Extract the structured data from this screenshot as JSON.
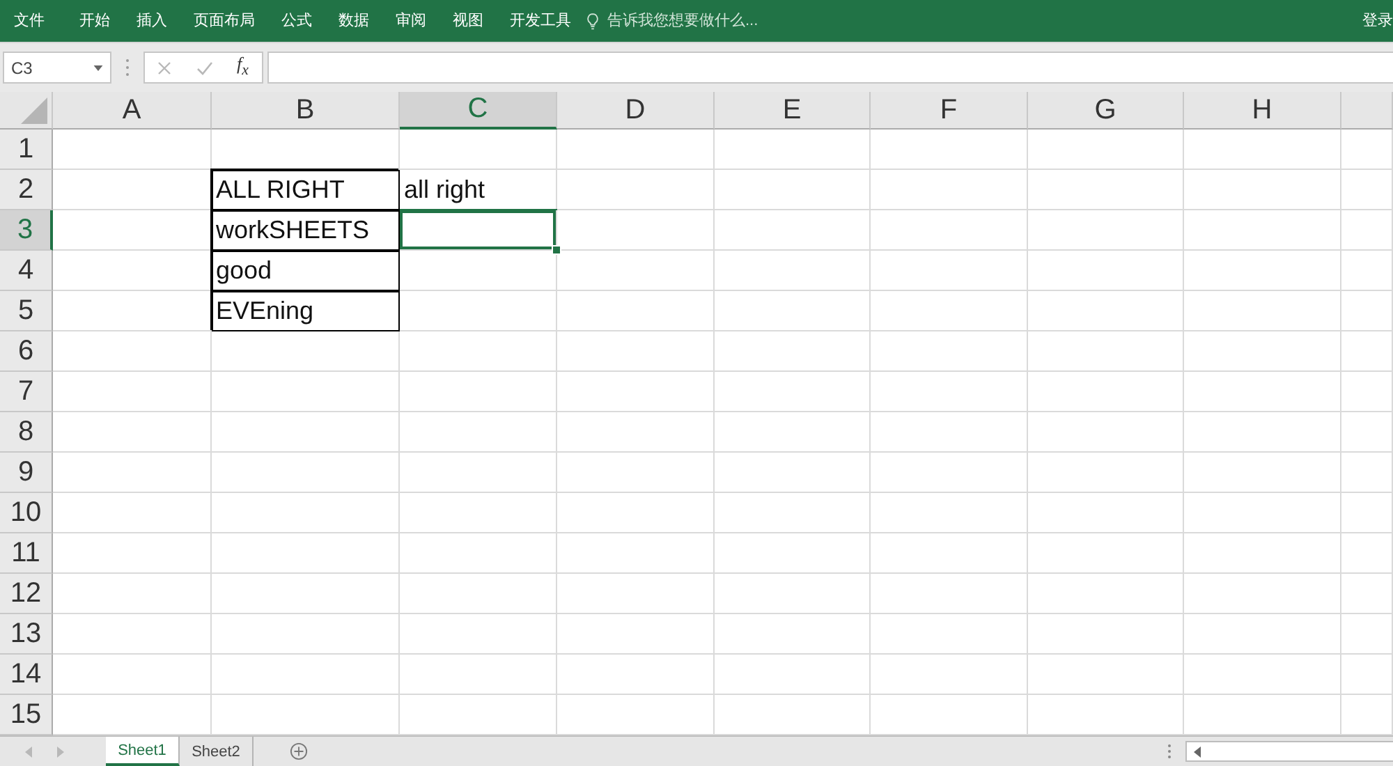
{
  "ribbon": {
    "tabs": [
      {
        "label": "文件",
        "selected": false
      },
      {
        "label": "开始",
        "selected": false
      },
      {
        "label": "插入",
        "selected": false
      },
      {
        "label": "页面布局",
        "selected": false
      },
      {
        "label": "公式",
        "selected": false
      },
      {
        "label": "数据",
        "selected": false
      },
      {
        "label": "审阅",
        "selected": false
      },
      {
        "label": "视图",
        "selected": false
      },
      {
        "label": "开发工具",
        "selected": false
      }
    ],
    "tell_me": {
      "placeholder": "告诉我您想要做什么..."
    },
    "sign_in": "登录"
  },
  "formula_bar": {
    "name_box": "C3",
    "cancel_disabled": true,
    "enter_disabled": true,
    "function_label": "f$_{x}$"
  },
  "columns": [
    {
      "label": "A",
      "selected": false
    },
    {
      "label": "B",
      "selected": false
    },
    {
      "label": "C",
      "selected": true
    },
    {
      "label": "D",
      "selected": false
    },
    {
      "label": "E",
      "selected": false
    },
    {
      "label": "F",
      "selected": false
    },
    {
      "label": "G",
      "selected": false
    },
    {
      "label": "H",
      "selected": false
    }
  ],
  "rows": [
    {
      "label": "1",
      "selected": false,
      "cells": [
        {
          "selected": false,
          "bordered": false
        },
        {
          "selected": false,
          "bordered": false
        },
        {
          "selected": false,
          "bordered": false
        },
        {
          "selected": false,
          "bordered": false
        },
        {
          "selected": false,
          "bordered": false
        },
        {
          "selected": false,
          "bordered": false
        },
        {
          "selected": false,
          "bordered": false
        },
        {
          "selected": false,
          "bordered": false
        }
      ]
    },
    {
      "label": "2",
      "selected": false,
      "cells": [
        {
          "selected": false,
          "bordered": false
        },
        {
          "text": "ALL RIGHT",
          "selected": false,
          "bordered": true
        },
        {
          "text": "all right",
          "selected": false,
          "bordered": false
        },
        {
          "selected": false,
          "bordered": false
        },
        {
          "selected": false,
          "bordered": false
        },
        {
          "selected": false,
          "bordered": false
        },
        {
          "selected": false,
          "bordered": false
        },
        {
          "selected": false,
          "bordered": false
        }
      ]
    },
    {
      "label": "3",
      "selected": true,
      "cells": [
        {
          "selected": false,
          "bordered": false
        },
        {
          "text": "workSHEETS",
          "selected": false,
          "bordered": true
        },
        {
          "selected": true,
          "bordered": false
        },
        {
          "selected": false,
          "bordered": false
        },
        {
          "selected": false,
          "bordered": false
        },
        {
          "selected": false,
          "bordered": false
        },
        {
          "selected": false,
          "bordered": false
        },
        {
          "selected": false,
          "bordered": false
        }
      ]
    },
    {
      "label": "4",
      "selected": false,
      "cells": [
        {
          "selected": false,
          "bordered": false
        },
        {
          "text": "good",
          "selected": false,
          "bordered": true
        },
        {
          "selected": false,
          "bordered": false
        },
        {
          "selected": false,
          "bordered": false
        },
        {
          "selected": false,
          "bordered": false
        },
        {
          "selected": false,
          "bordered": false
        },
        {
          "selected": false,
          "bordered": false
        },
        {
          "selected": false,
          "bordered": false
        }
      ]
    },
    {
      "label": "5",
      "selected": false,
      "cells": [
        {
          "selected": false,
          "bordered": false
        },
        {
          "text": "EVEning",
          "selected": false,
          "bordered": true
        },
        {
          "selected": false,
          "bordered": false
        },
        {
          "selected": false,
          "bordered": false
        },
        {
          "selected": false,
          "bordered": false
        },
        {
          "selected": false,
          "bordered": false
        },
        {
          "selected": false,
          "bordered": false
        },
        {
          "selected": false,
          "bordered": false
        }
      ]
    },
    {
      "label": "6",
      "selected": false,
      "cells": [
        {
          "selected": false,
          "bordered": false
        },
        {
          "selected": false,
          "bordered": false
        },
        {
          "selected": false,
          "bordered": false
        },
        {
          "selected": false,
          "bordered": false
        },
        {
          "selected": false,
          "bordered": false
        },
        {
          "selected": false,
          "bordered": false
        },
        {
          "selected": false,
          "bordered": false
        },
        {
          "selected": false,
          "bordered": false
        }
      ]
    },
    {
      "label": "7",
      "selected": false,
      "cells": [
        {
          "selected": false,
          "bordered": false
        },
        {
          "selected": false,
          "bordered": false
        },
        {
          "selected": false,
          "bordered": false
        },
        {
          "selected": false,
          "bordered": false
        },
        {
          "selected": false,
          "bordered": false
        },
        {
          "selected": false,
          "bordered": false
        },
        {
          "selected": false,
          "bordered": false
        },
        {
          "selected": false,
          "bordered": false
        }
      ]
    },
    {
      "label": "8",
      "selected": false,
      "cells": [
        {
          "selected": false,
          "bordered": false
        },
        {
          "selected": false,
          "bordered": false
        },
        {
          "selected": false,
          "bordered": false
        },
        {
          "selected": false,
          "bordered": false
        },
        {
          "selected": false,
          "bordered": false
        },
        {
          "selected": false,
          "bordered": false
        },
        {
          "selected": false,
          "bordered": false
        },
        {
          "selected": false,
          "bordered": false
        }
      ]
    },
    {
      "label": "9",
      "selected": false,
      "cells": [
        {
          "selected": false,
          "bordered": false
        },
        {
          "selected": false,
          "bordered": false
        },
        {
          "selected": false,
          "bordered": false
        },
        {
          "selected": false,
          "bordered": false
        },
        {
          "selected": false,
          "bordered": false
        },
        {
          "selected": false,
          "bordered": false
        },
        {
          "selected": false,
          "bordered": false
        },
        {
          "selected": false,
          "bordered": false
        }
      ]
    },
    {
      "label": "10",
      "selected": false,
      "cells": [
        {
          "selected": false,
          "bordered": false
        },
        {
          "selected": false,
          "bordered": false
        },
        {
          "selected": false,
          "bordered": false
        },
        {
          "selected": false,
          "bordered": false
        },
        {
          "selected": false,
          "bordered": false
        },
        {
          "selected": false,
          "bordered": false
        },
        {
          "selected": false,
          "bordered": false
        },
        {
          "selected": false,
          "bordered": false
        }
      ]
    },
    {
      "label": "11",
      "selected": false,
      "cells": [
        {
          "selected": false,
          "bordered": false
        },
        {
          "selected": false,
          "bordered": false
        },
        {
          "selected": false,
          "bordered": false
        },
        {
          "selected": false,
          "bordered": false
        },
        {
          "selected": false,
          "bordered": false
        },
        {
          "selected": false,
          "bordered": false
        },
        {
          "selected": false,
          "bordered": false
        },
        {
          "selected": false,
          "bordered": false
        }
      ]
    },
    {
      "label": "12",
      "selected": false,
      "cells": [
        {
          "selected": false,
          "bordered": false
        },
        {
          "selected": false,
          "bordered": false
        },
        {
          "selected": false,
          "bordered": false
        },
        {
          "selected": false,
          "bordered": false
        },
        {
          "selected": false,
          "bordered": false
        },
        {
          "selected": false,
          "bordered": false
        },
        {
          "selected": false,
          "bordered": false
        },
        {
          "selected": false,
          "bordered": false
        }
      ]
    },
    {
      "label": "13",
      "selected": false,
      "cells": [
        {
          "selected": false,
          "bordered": false
        },
        {
          "selected": false,
          "bordered": false
        },
        {
          "selected": false,
          "bordered": false
        },
        {
          "selected": false,
          "bordered": false
        },
        {
          "selected": false,
          "bordered": false
        },
        {
          "selected": false,
          "bordered": false
        },
        {
          "selected": false,
          "bordered": false
        },
        {
          "selected": false,
          "bordered": false
        }
      ]
    },
    {
      "label": "14",
      "selected": false,
      "cells": [
        {
          "selected": false,
          "bordered": false
        },
        {
          "selected": false,
          "bordered": false
        },
        {
          "selected": false,
          "bordered": false
        },
        {
          "selected": false,
          "bordered": false
        },
        {
          "selected": false,
          "bordered": false
        },
        {
          "selected": false,
          "bordered": false
        },
        {
          "selected": false,
          "bordered": false
        },
        {
          "selected": false,
          "bordered": false
        }
      ]
    },
    {
      "label": "15",
      "selected": false,
      "cells": [
        {
          "selected": false,
          "bordered": false
        },
        {
          "selected": false,
          "bordered": false
        },
        {
          "selected": false,
          "bordered": false
        },
        {
          "selected": false,
          "bordered": false
        },
        {
          "selected": false,
          "bordered": false
        },
        {
          "selected": false,
          "bordered": false
        },
        {
          "selected": false,
          "bordered": false
        },
        {
          "selected": false,
          "bordered": false
        }
      ]
    }
  ],
  "sheet_tabs": [
    {
      "label": "Sheet1",
      "selected": true
    },
    {
      "label": "Sheet2",
      "selected": false
    }
  ]
}
